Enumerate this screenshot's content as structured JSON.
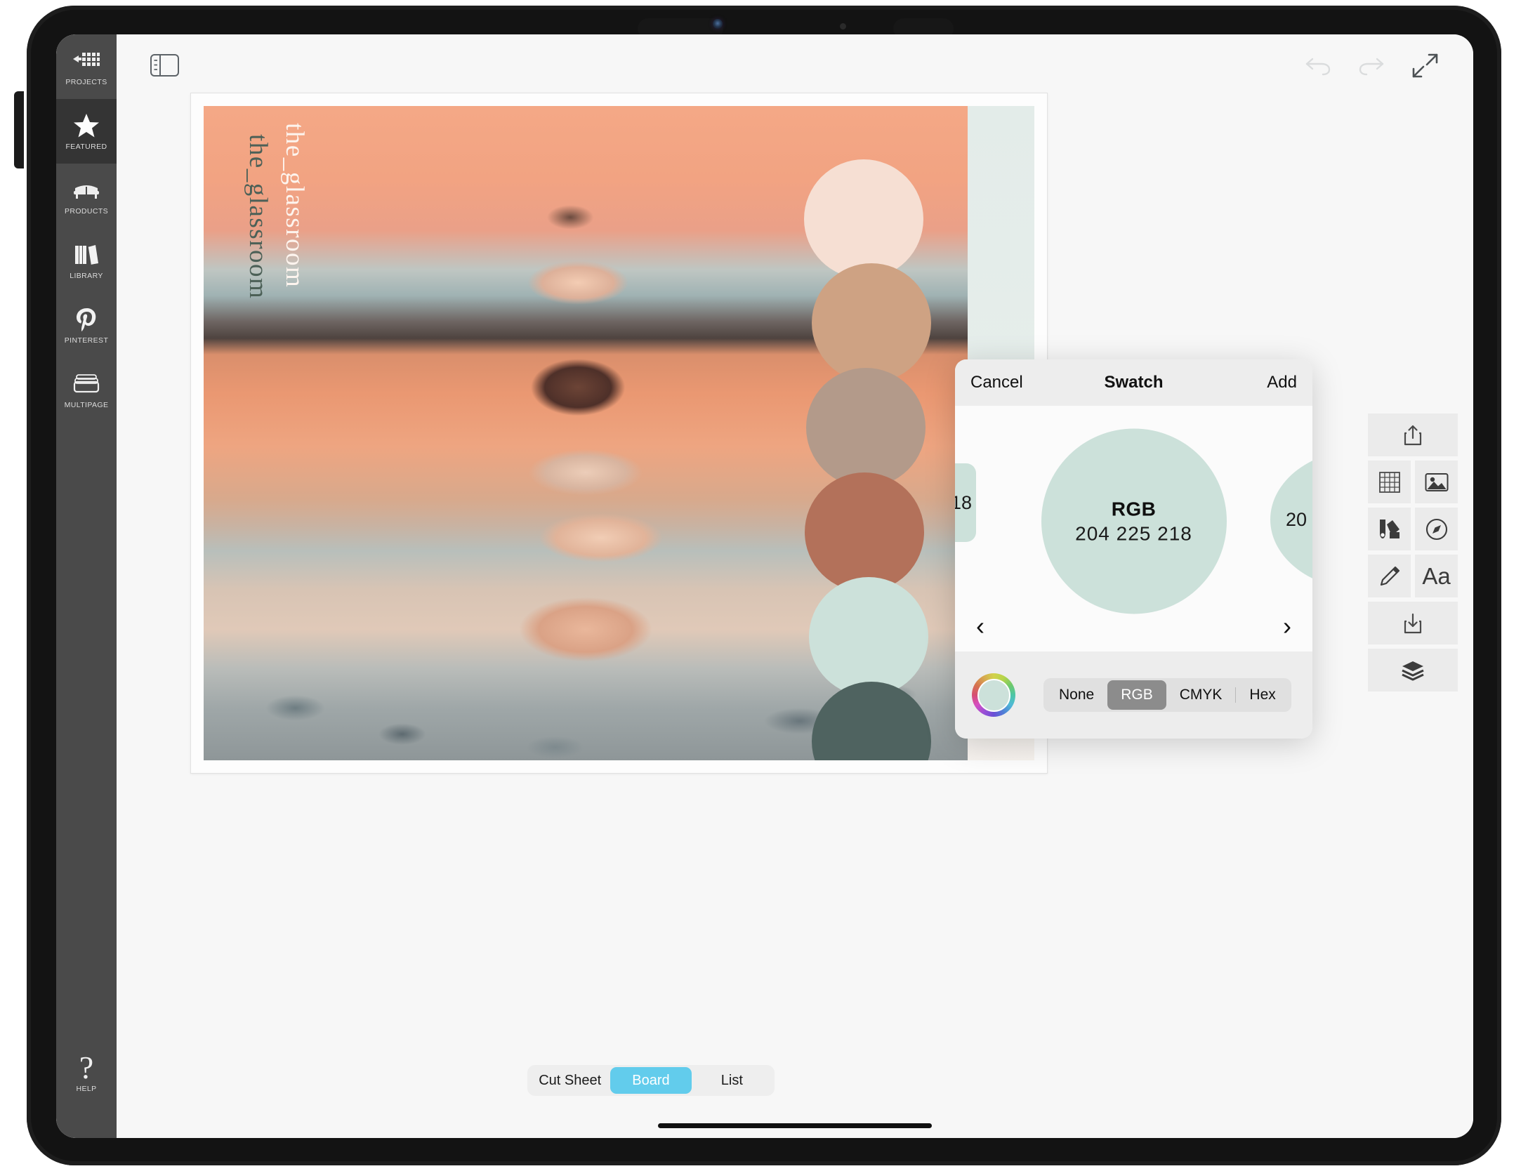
{
  "app": {
    "rail": {
      "items": [
        {
          "label": "PROJECTS",
          "icon": "projects-grid-icon",
          "active": false
        },
        {
          "label": "FEATURED",
          "icon": "star-icon",
          "active": true
        },
        {
          "label": "PRODUCTS",
          "icon": "sofa-icon",
          "active": false
        },
        {
          "label": "LIBRARY",
          "icon": "books-icon",
          "active": false
        },
        {
          "label": "PINTEREST",
          "icon": "pinterest-icon",
          "active": false
        },
        {
          "label": "MULTIPAGE",
          "icon": "multipage-icon",
          "active": false
        }
      ],
      "help_label": "HELP",
      "help_icon": "question-mark-icon"
    },
    "topbar": {
      "sidebar_toggle_icon": "sidebar-panel-icon",
      "undo_icon": "undo-arrow-icon",
      "redo_icon": "redo-arrow-icon",
      "expand_icon": "expand-diagonal-arrows-icon",
      "undo_enabled": "false",
      "redo_enabled": "false"
    },
    "artboard": {
      "text_white": "the_glassroom",
      "text_green": "the_glassroom",
      "text_green_color": "#4c6057",
      "swatches": [
        {
          "name": "blush",
          "hex": "#f6dfd3"
        },
        {
          "name": "tan",
          "hex": "#cea283"
        },
        {
          "name": "taupe",
          "hex": "#b39a8a"
        },
        {
          "name": "terracotta",
          "hex": "#b3715a"
        },
        {
          "name": "mint",
          "hex": "#cce1da"
        },
        {
          "name": "slate-green",
          "hex": "#4f6360"
        }
      ]
    },
    "tools": [
      {
        "name": "share-icon",
        "label": "Share"
      },
      {
        "name": "grid-icon",
        "label": "Grid"
      },
      {
        "name": "image-icon",
        "label": "Image"
      },
      {
        "name": "color-palette-icon",
        "label": "Colors"
      },
      {
        "name": "compass-icon",
        "label": "Compass"
      },
      {
        "name": "pencil-icon",
        "label": "Draw"
      },
      {
        "name": "text-icon",
        "label": "Aa"
      },
      {
        "name": "download-icon",
        "label": "Download"
      },
      {
        "name": "layers-icon",
        "label": "Layers"
      }
    ],
    "view_tabs": {
      "options": [
        "Cut Sheet",
        "Board",
        "List"
      ],
      "selected": "Board",
      "accent": "#62ccec"
    }
  },
  "swatch_modal": {
    "cancel_label": "Cancel",
    "title": "Swatch",
    "add_label": "Add",
    "mode_label": "RGB",
    "value": "204 225 218",
    "swatch_hex": "#cce1da",
    "prev_partial_text": "18",
    "prev_partial_hex": "#cce1da",
    "next_partial_text": "20",
    "next_partial_hex": "#cce1da",
    "arrow_prev": "‹",
    "arrow_next": "›",
    "wheel_icon": "color-wheel-icon",
    "wheel_center_hex": "#cce1da",
    "formats": [
      "None",
      "RGB",
      "CMYK",
      "Hex"
    ],
    "format_selected": "RGB"
  }
}
